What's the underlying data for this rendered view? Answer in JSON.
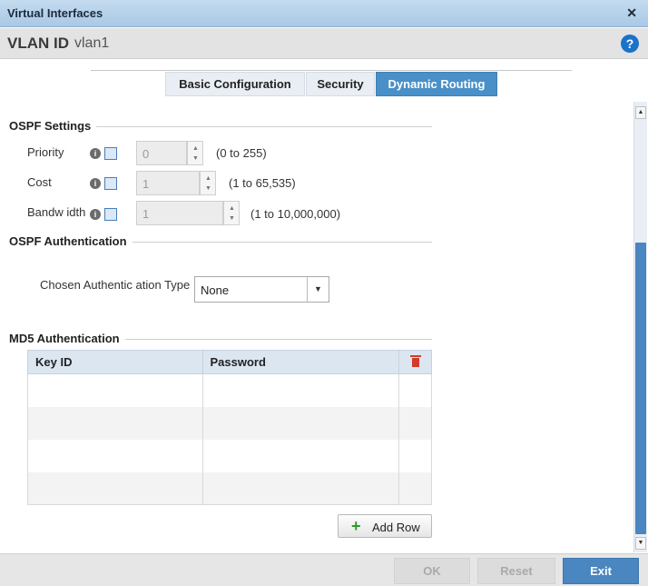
{
  "window": {
    "title": "Virtual Interfaces",
    "close_icon": "close-icon"
  },
  "header": {
    "vlan_label": "VLAN ID",
    "vlan_value": "vlan1"
  },
  "tabs": [
    {
      "label": "Basic Configuration",
      "active": false
    },
    {
      "label": "Security",
      "active": false
    },
    {
      "label": "Dynamic Routing",
      "active": true
    }
  ],
  "ospf": {
    "section_title": "OSPF Settings",
    "priority": {
      "label": "Priority",
      "value": "0",
      "range": "(0 to 255)"
    },
    "cost": {
      "label": "Cost",
      "value": "1",
      "range": "(1 to 65,535)"
    },
    "bandwidth": {
      "label": "Bandw idth",
      "value": "1",
      "range": "(1 to 10,000,000)"
    }
  },
  "auth": {
    "section_title": "OSPF Authentication",
    "type_label": "Chosen Authentic ation Type",
    "type_value": "None"
  },
  "md5": {
    "section_title": "MD5 Authentication",
    "columns": [
      "Key ID",
      "Password"
    ],
    "rows": [],
    "add_row_label": "Add Row"
  },
  "footer": {
    "ok_label": "OK",
    "reset_label": "Reset",
    "exit_label": "Exit"
  },
  "colors": {
    "accent": "#4a86c0",
    "active_tab": "#4a90c8",
    "trash": "#d03c2e",
    "add_plus": "#2e9b2e",
    "help": "#1a73c9"
  }
}
